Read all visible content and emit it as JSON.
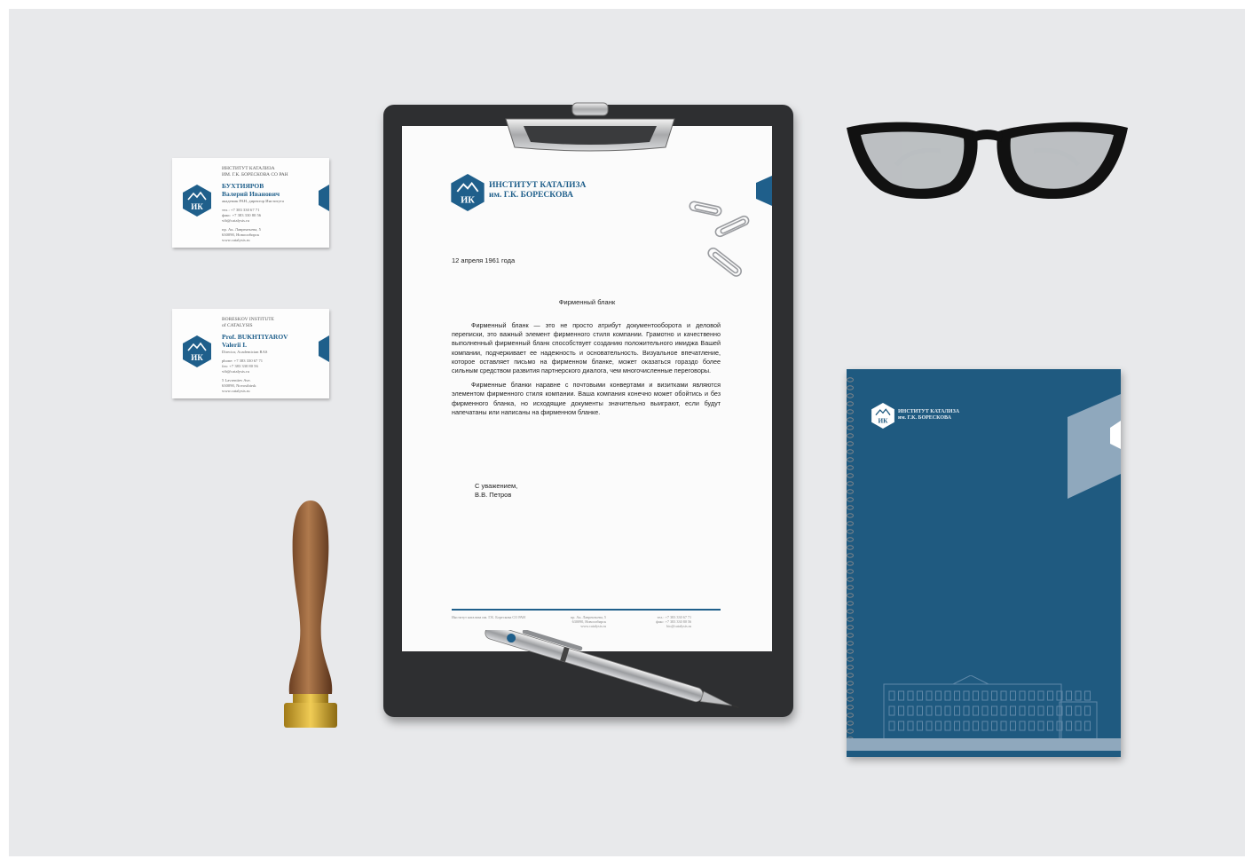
{
  "colors": {
    "brand_blue": "#1f5f8b",
    "notebook_blue": "#1f5a80",
    "background": "#e8e9eb"
  },
  "logo_mark": "ИК",
  "card_ru": {
    "org_line1": "ИНСТИТУТ КАТАЛИЗА",
    "org_line2": "ИМ. Г.К. БОРЕСКОВА СО РАН",
    "surname": "БУХТИЯРОВ",
    "given": "Валерий Иванович",
    "position": "академик РАН, директор Института",
    "tel": "тел.: +7 383 330 67 71",
    "fax": "факс: +7 383 330 80 56",
    "email": "vib@catalysis.ru",
    "address1": "пр. Ак. Лаврентьева, 5",
    "address2": "630090, Новосибирск",
    "web": "www.catalysis.ru"
  },
  "card_en": {
    "org_line1": "BORESKOV INSTITUTE",
    "org_line2": "of CATALYSIS",
    "surname": "Prof. BUKHTIYAROV",
    "given": "Valerii I.",
    "position": "Director, Academician RAS",
    "tel": "phone: +7 383 330 67 71",
    "fax": "fax: +7 383 330 80 56",
    "email": "vib@catalysis.ru",
    "address1": "5 Lavrentiev Ave.",
    "address2": "630090, Novosibirsk",
    "web": "www.catalysis.ru"
  },
  "letter": {
    "brand_line1": "ИНСТИТУТ КАТАЛИЗА",
    "brand_line2": "им. Г.К. БОРЕСКОВА",
    "date": "12 апреля 1961 года",
    "title": "Фирменный бланк",
    "paragraph1": "Фирменный бланк — это не просто атрибут документооборота и деловой переписки, это важный элемент фирменного стиля компании. Грамотно и качественно выполненный фирменный бланк способствует созданию положительного имиджа Вашей компании, подчеркивает ее надежность и основательность. Визуальное впечатление, которое оставляет письмо на фирменном бланке, может оказаться гораздо более сильным средством развития партнерского диалога, чем многочисленные переговоры.",
    "paragraph2": "Фирменные бланки наравне с почтовыми конвертами и визитками являются элементом фирменного стиля компании. Ваша компания конечно может обойтись и без фирменного бланка, но исходящие документы значительно выиграют, если будут напечатаны или написаны на фирменном бланке.",
    "closing": "С уважением,",
    "signature": "В.В. Петров",
    "footer_org": "Институт катализа им. Г.К. Борескова СО РАН",
    "footer_addr1": "пр. Ак. Лаврентьева, 5",
    "footer_addr2": "630090, Новосибирск",
    "footer_web": "www.catalysis.ru",
    "footer_tel": "тел.: +7 383 330 67 71",
    "footer_fax": "факс: +7 383 330 80 56",
    "footer_email": "bic@catalysis.ru"
  },
  "notebook": {
    "brand_line1": "ИНСТИТУТ КАТАЛИЗА",
    "brand_line2": "им. Г.К. БОРЕСКОВА"
  }
}
